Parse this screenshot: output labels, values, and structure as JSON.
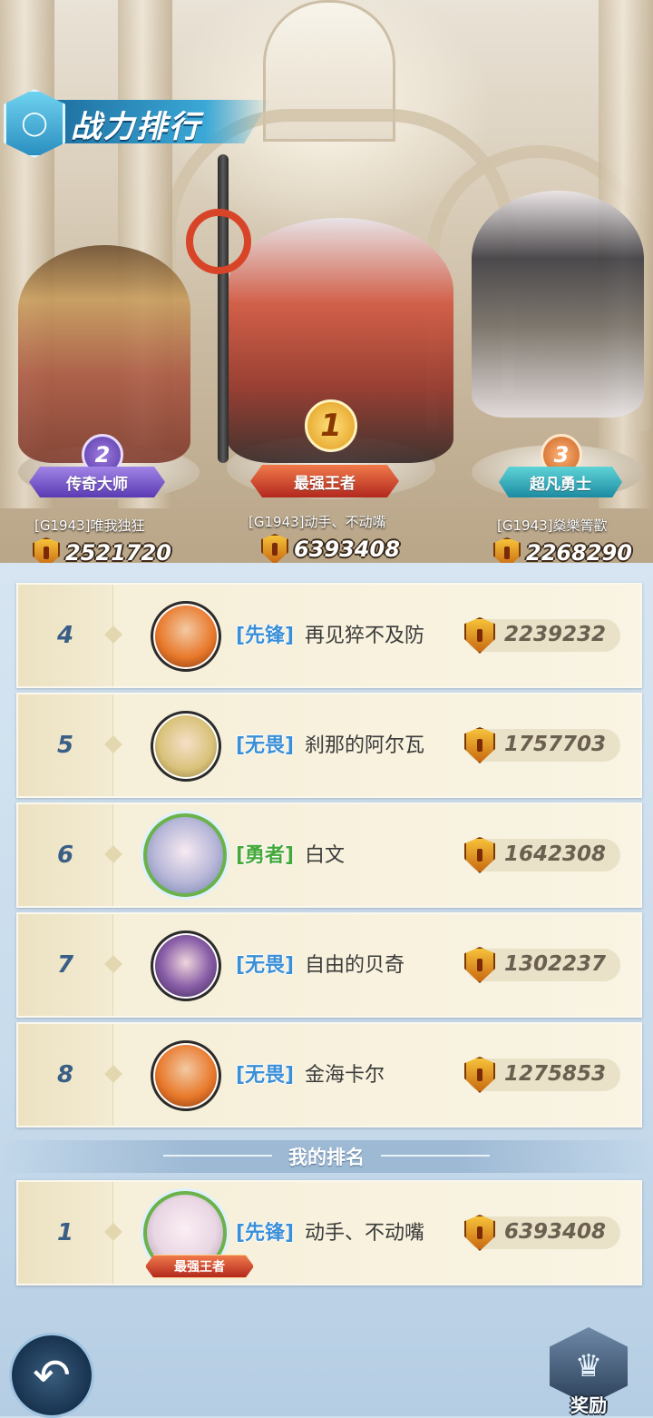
{
  "header": {
    "title": "战力排行"
  },
  "podium": [
    {
      "rank": "2",
      "title": "传奇大师",
      "name": "[G1943]唯我独狂",
      "power": "2521720",
      "color": "#6b4bc6"
    },
    {
      "rank": "1",
      "title": "最强王者",
      "name": "[G1943]动手、不动嘴",
      "power": "6393408",
      "color": "#c63a24"
    },
    {
      "rank": "3",
      "title": "超凡勇士",
      "name": "[G1943]燊樂箐歡",
      "power": "2268290",
      "color": "#2a9ab0"
    }
  ],
  "rows": [
    {
      "rank": "4",
      "guild": "[先锋]",
      "name": "再见猝不及防",
      "power": "2239232",
      "avatar": "orange-haired-elf",
      "avatar_color": "#e8782a"
    },
    {
      "rank": "5",
      "guild": "[无畏]",
      "name": "刹那的阿尔瓦",
      "power": "1757703",
      "avatar": "blonde-elf",
      "avatar_color": "#d9c27a"
    },
    {
      "rank": "6",
      "guild": "[勇者]",
      "name": "白文",
      "power": "1642308",
      "avatar": "silver-haired-girl-framed",
      "avatar_color": "#b7b7d8"
    },
    {
      "rank": "7",
      "guild": "[无畏]",
      "name": "自由的贝奇",
      "power": "1302237",
      "avatar": "purple-haired-hero",
      "avatar_color": "#5b3f78"
    },
    {
      "rank": "8",
      "guild": "[无畏]",
      "name": "金海卡尔",
      "power": "1275853",
      "avatar": "orange-haired-elf",
      "avatar_color": "#e8782a"
    }
  ],
  "my_rank": {
    "label": "我的排名",
    "rank": "1",
    "guild": "[先锋]",
    "name": "动手、不动嘴",
    "power": "6393408",
    "title_tag": "最强王者",
    "avatar": "white-haired-girl-framed",
    "avatar_color": "#e9d7e4"
  },
  "buttons": {
    "back_icon": "back-arrow-icon",
    "reward_label": "奖励",
    "reward_icon": "crown-icon"
  },
  "colors": {
    "guild_blue": "#3b8fd6",
    "guild_green": "#46a83a",
    "rank_text": "#3a5f86"
  }
}
